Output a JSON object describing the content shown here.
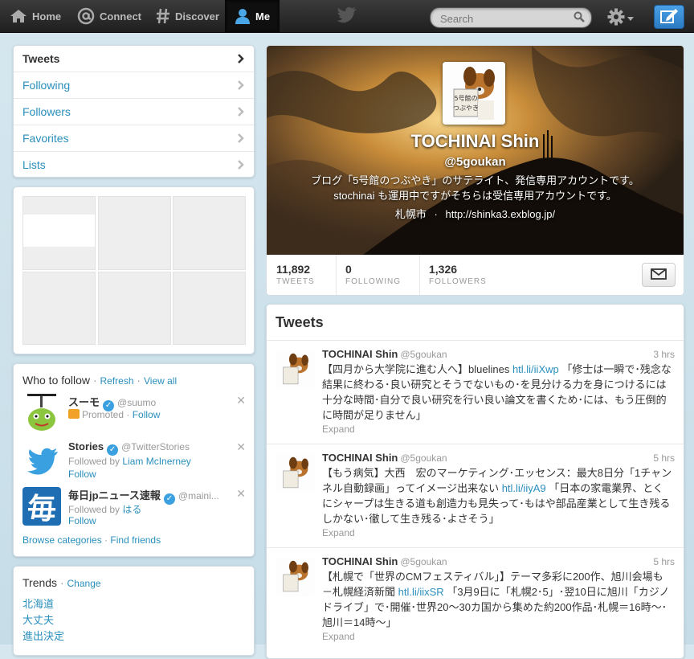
{
  "topbar": {
    "home": "Home",
    "connect": "Connect",
    "discover": "Discover",
    "me": "Me",
    "search_placeholder": "Search"
  },
  "profile_nav": [
    {
      "label": "Tweets"
    },
    {
      "label": "Following"
    },
    {
      "label": "Followers"
    },
    {
      "label": "Favorites"
    },
    {
      "label": "Lists"
    }
  ],
  "who_to_follow": {
    "title": "Who to follow",
    "sep": "·",
    "refresh": "Refresh",
    "view_all": "View all",
    "users": [
      {
        "name": "スーモ",
        "handle": "@suumo",
        "sub_prefix": "",
        "sub_text": "Promoted",
        "follow_inline": "Follow",
        "follow": ""
      },
      {
        "name": "Stories",
        "handle": "@TwitterStories",
        "sub_prefix": "Followed by ",
        "sub_link": "Liam McInerney",
        "follow": "Follow"
      },
      {
        "name": "毎日jpニュース速報",
        "handle": "@maini...",
        "sub_prefix": "Followed by ",
        "sub_link": "はる",
        "follow": "Follow"
      }
    ],
    "browse": "Browse categories",
    "find": "Find friends",
    "mainichi_glyph": "毎"
  },
  "trends": {
    "title": "Trends",
    "change": "Change",
    "items": [
      "北海道",
      "大丈夫",
      "進出決定"
    ]
  },
  "profile": {
    "name": "TOCHINAI Shin",
    "handle": "@5goukan",
    "bio_line1": "ブログ「5号館のつぶやき」のサテライト、発信専用アカウントです。",
    "bio_line2": "stochinai も運用中ですがそちらは受信専用アカウントです。",
    "location": "札幌市",
    "loc_sep": "·",
    "url": "http://shinka3.exblog.jp/",
    "avatar_text": "5号館のつぶやき",
    "stats": [
      {
        "num": "11,892",
        "label": "TWEETS"
      },
      {
        "num": "0",
        "label": "FOLLOWING"
      },
      {
        "num": "1,326",
        "label": "FOLLOWERS"
      }
    ]
  },
  "tweets": {
    "title": "Tweets",
    "expand": "Expand",
    "items": [
      {
        "name": "TOCHINAI Shin",
        "handle": "@5goukan",
        "time": "3 hrs",
        "pre": "【四月から大学院に進む人へ】bluelines ",
        "link": "htl.li/iiXwp",
        "post": " 「修士は一瞬で･残念な結果に終わる･良い研究とそうでないもの･を見分ける力を身につけるには十分な時間･自分で良い研究を行い良い論文を書くため･には、もう圧倒的に時間が足りません」"
      },
      {
        "name": "TOCHINAI Shin",
        "handle": "@5goukan",
        "time": "5 hrs",
        "pre": "【もう病気】大西　宏のマーケティング･エッセンス：最大8日分「1チャンネル自動録画」ってイメージ出来ない ",
        "link": "htl.li/iiyA9",
        "post": " 「日本の家電業界、とくにシャープは生きる道も創造力も見失って･もはや部品産業として生き残るしかない･徹して生き残る･よさそう」"
      },
      {
        "name": "TOCHINAI Shin",
        "handle": "@5goukan",
        "time": "5 hrs",
        "pre": "【札幌で「世界のCMフェスティバル」】テーマ多彩に200作、旭川会場も－札幌経済新聞 ",
        "link": "htl.li/iixSR",
        "post": " 「3月9日に「札幌2･5」･翌10日に旭川「カジノドライブ」で･開催･世界20～30カ国から集めた約200作品･札幌＝16時～･旭川＝14時～」"
      }
    ]
  },
  "colors": {
    "link": "#2a8fbd",
    "topbar": "#2b2b2b",
    "verified": "#3aa0e0",
    "compose": "#3a8fd6"
  },
  "icons": [
    "home-icon",
    "connect-icon",
    "discover-icon",
    "me-icon",
    "twitter-bird-icon",
    "search-icon",
    "gear-icon",
    "compose-icon",
    "chevron-right-icon",
    "close-icon",
    "verified-icon",
    "envelope-icon"
  ]
}
